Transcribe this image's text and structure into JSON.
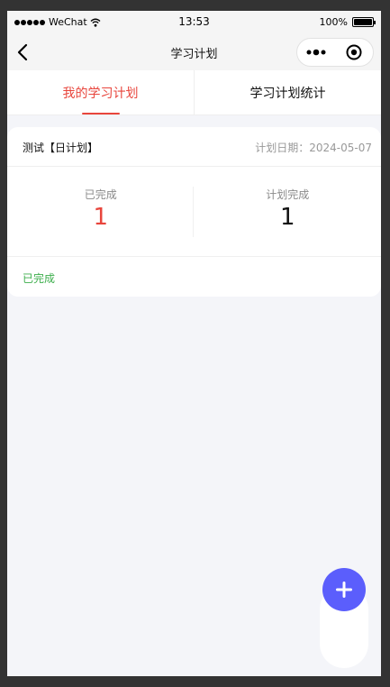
{
  "status_bar": {
    "carrier": "WeChat",
    "time": "13:53",
    "battery": "100%"
  },
  "nav": {
    "title": "学习计划"
  },
  "tabs": [
    {
      "label": "我的学习计划",
      "active": true
    },
    {
      "label": "学习计划统计",
      "active": false
    }
  ],
  "plans": [
    {
      "name": "测试【日计划】",
      "date_label": "计划日期：2024-05-07",
      "completed_label": "已完成",
      "completed_value": "1",
      "target_label": "计划完成",
      "target_value": "1",
      "status": "已完成"
    }
  ],
  "fab": {
    "icon": "plus-icon"
  },
  "colors": {
    "accent": "#e8453c",
    "fab": "#5b5efc",
    "status_done": "#3cae4b",
    "background": "#f4f5f9"
  }
}
